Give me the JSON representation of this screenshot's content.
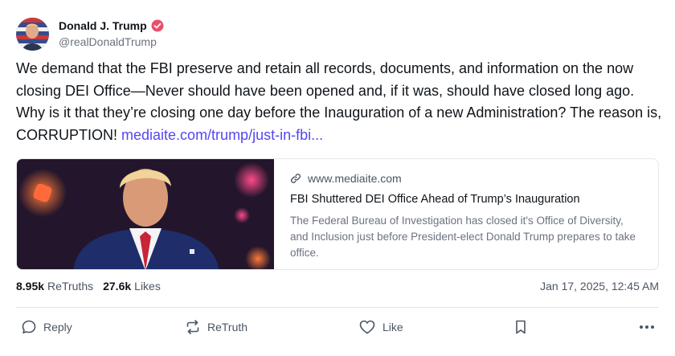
{
  "author": {
    "display_name": "Donald J. Trump",
    "handle": "@realDonaldTrump",
    "verified": true,
    "verified_color": "#e94f6b"
  },
  "post": {
    "text": "We demand that the FBI preserve and retain all records, documents, and information on the now closing DEI Office—Never should have been opened and, if it was, should have closed long ago. Why is it that they’re closing one day before the Inauguration of a new Administration? The reason is, CORRUPTION! ",
    "link_text": "mediaite.com/trump/just-in-fbi...",
    "link_color": "#5448ee"
  },
  "link_card": {
    "domain": "www.mediaite.com",
    "title": "FBI Shuttered DEI Office Ahead of Trump’s Inauguration",
    "description": "The Federal Bureau of Investigation has closed it's Office of Diversity, and Inclusion just before President-elect Donald Trump prepares to take office.",
    "icon": "link-icon"
  },
  "stats": {
    "retruths_count": "8.95k",
    "retruths_label": "ReTruths",
    "likes_count": "27.6k",
    "likes_label": "Likes",
    "timestamp": "Jan 17, 2025, 12:45 AM"
  },
  "actions": {
    "reply_label": "Reply",
    "retruth_label": "ReTruth",
    "like_label": "Like",
    "icons": [
      "reply-icon",
      "retruth-icon",
      "like-icon",
      "bookmark-icon",
      "more-icon"
    ]
  }
}
